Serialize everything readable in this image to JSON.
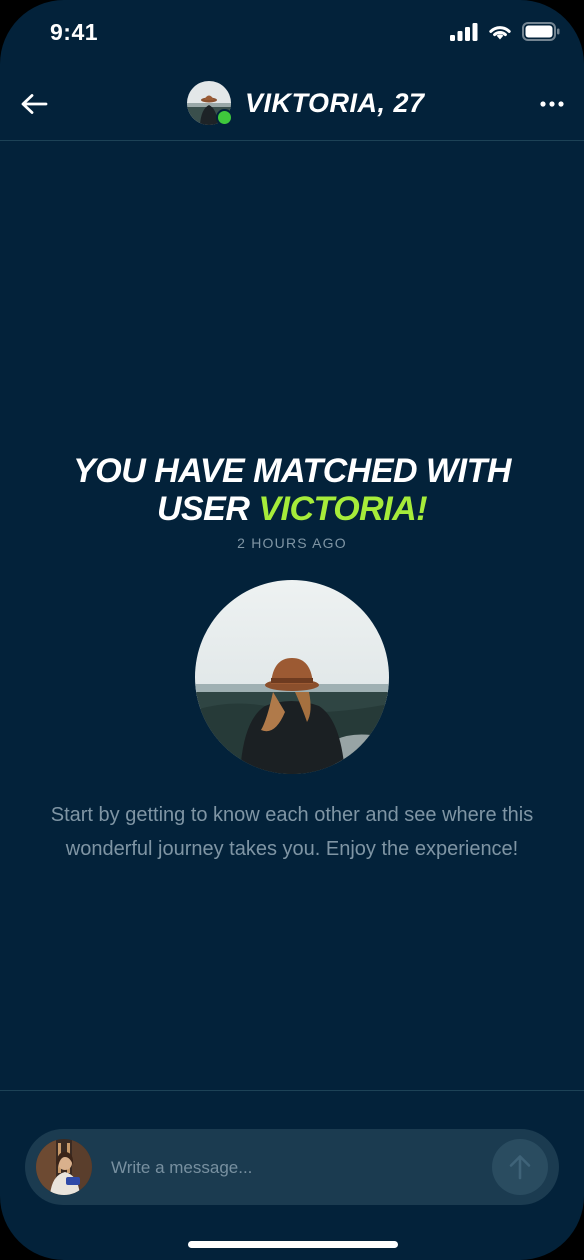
{
  "status_bar": {
    "time": "9:41",
    "icons": [
      "signal-icon",
      "wifi-icon",
      "battery-icon"
    ]
  },
  "header": {
    "back_icon": "arrow-left-icon",
    "name": "VIKTORIA, 27",
    "online": true,
    "more_icon": "more-horizontal-icon"
  },
  "match": {
    "title_line1": "YOU HAVE MATCHED WITH",
    "title_prefix": "USER ",
    "title_highlight": "VICTORIA!",
    "time": "2 HOURS AGO",
    "intro_text": "Start by getting to know each other and see where this wonderful journey takes you. Enjoy the experience!"
  },
  "composer": {
    "placeholder": "Write a message...",
    "value": "",
    "send_icon": "arrow-up-icon"
  },
  "colors": {
    "background": "#03223a",
    "accent": "#a6ec3a",
    "online": "#3fc83c",
    "muted_text": "#7f95a4",
    "composer": "#1b3b50"
  }
}
